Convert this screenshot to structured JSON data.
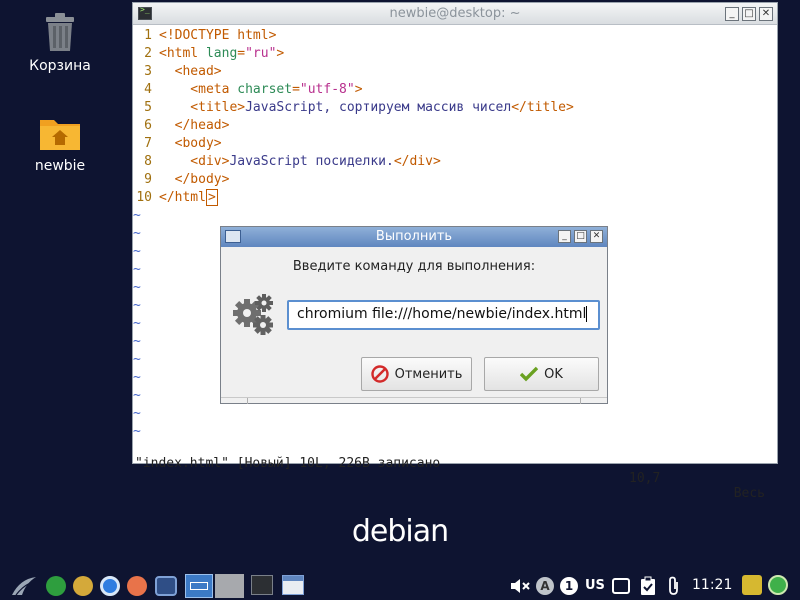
{
  "desktop": {
    "icons": [
      {
        "label": "Корзина",
        "icon": "trash-icon"
      },
      {
        "label": "newbie",
        "icon": "home-folder-icon"
      }
    ],
    "brand": "debian"
  },
  "terminal": {
    "title": "newbie@desktop: ~",
    "lines": [
      {
        "num": "1",
        "parts": [
          [
            "tag",
            "<!DOCTYPE html>"
          ]
        ]
      },
      {
        "num": "2",
        "parts": [
          [
            "tag",
            "<html "
          ],
          [
            "attr",
            "lang"
          ],
          [
            "tag",
            "="
          ],
          [
            "str",
            "\"ru\""
          ],
          [
            "tag",
            ">"
          ]
        ]
      },
      {
        "num": "3",
        "parts": [
          [
            "tag",
            "  <head>"
          ]
        ]
      },
      {
        "num": "4",
        "parts": [
          [
            "tag",
            "    <meta "
          ],
          [
            "attr",
            "charset"
          ],
          [
            "tag",
            "="
          ],
          [
            "str",
            "\"utf-8\""
          ],
          [
            "tag",
            ">"
          ]
        ]
      },
      {
        "num": "5",
        "parts": [
          [
            "tag",
            "    <title>"
          ],
          [
            "txt",
            "JavaScript, сортируем массив чисел"
          ],
          [
            "tag",
            "</title>"
          ]
        ]
      },
      {
        "num": "6",
        "parts": [
          [
            "tag",
            "  </head>"
          ]
        ]
      },
      {
        "num": "7",
        "parts": [
          [
            "tag",
            "  <body>"
          ]
        ]
      },
      {
        "num": "8",
        "parts": [
          [
            "tag",
            "    <div>"
          ],
          [
            "txt",
            "JavaScript посиделки."
          ],
          [
            "tag",
            "</div>"
          ]
        ]
      },
      {
        "num": "9",
        "parts": [
          [
            "tag",
            "  </body>"
          ]
        ]
      },
      {
        "num": "10",
        "parts": [
          [
            "tag",
            "</html"
          ],
          [
            "cursor",
            ">"
          ]
        ]
      }
    ],
    "tilde": "~",
    "tilde_count": 13,
    "status_left": "\"index.html\" [Новый] 10L, 226B записано",
    "status_pos": "10,7",
    "status_right": "Весь"
  },
  "dialog": {
    "title": "Выполнить",
    "prompt": "Введите команду для выполнения:",
    "command": "chromium file:///home/newbie/index.html",
    "cancel_label": "Отменить",
    "ok_label": "OK"
  },
  "taskbar": {
    "layout": "US",
    "workspace": "1",
    "clock": "11:21"
  },
  "colors": {
    "desktop_bg": "#0e1431",
    "dialog_title": "#6b90c6",
    "ok_check": "#6aa121",
    "cancel_icon": "#d32a2a"
  }
}
